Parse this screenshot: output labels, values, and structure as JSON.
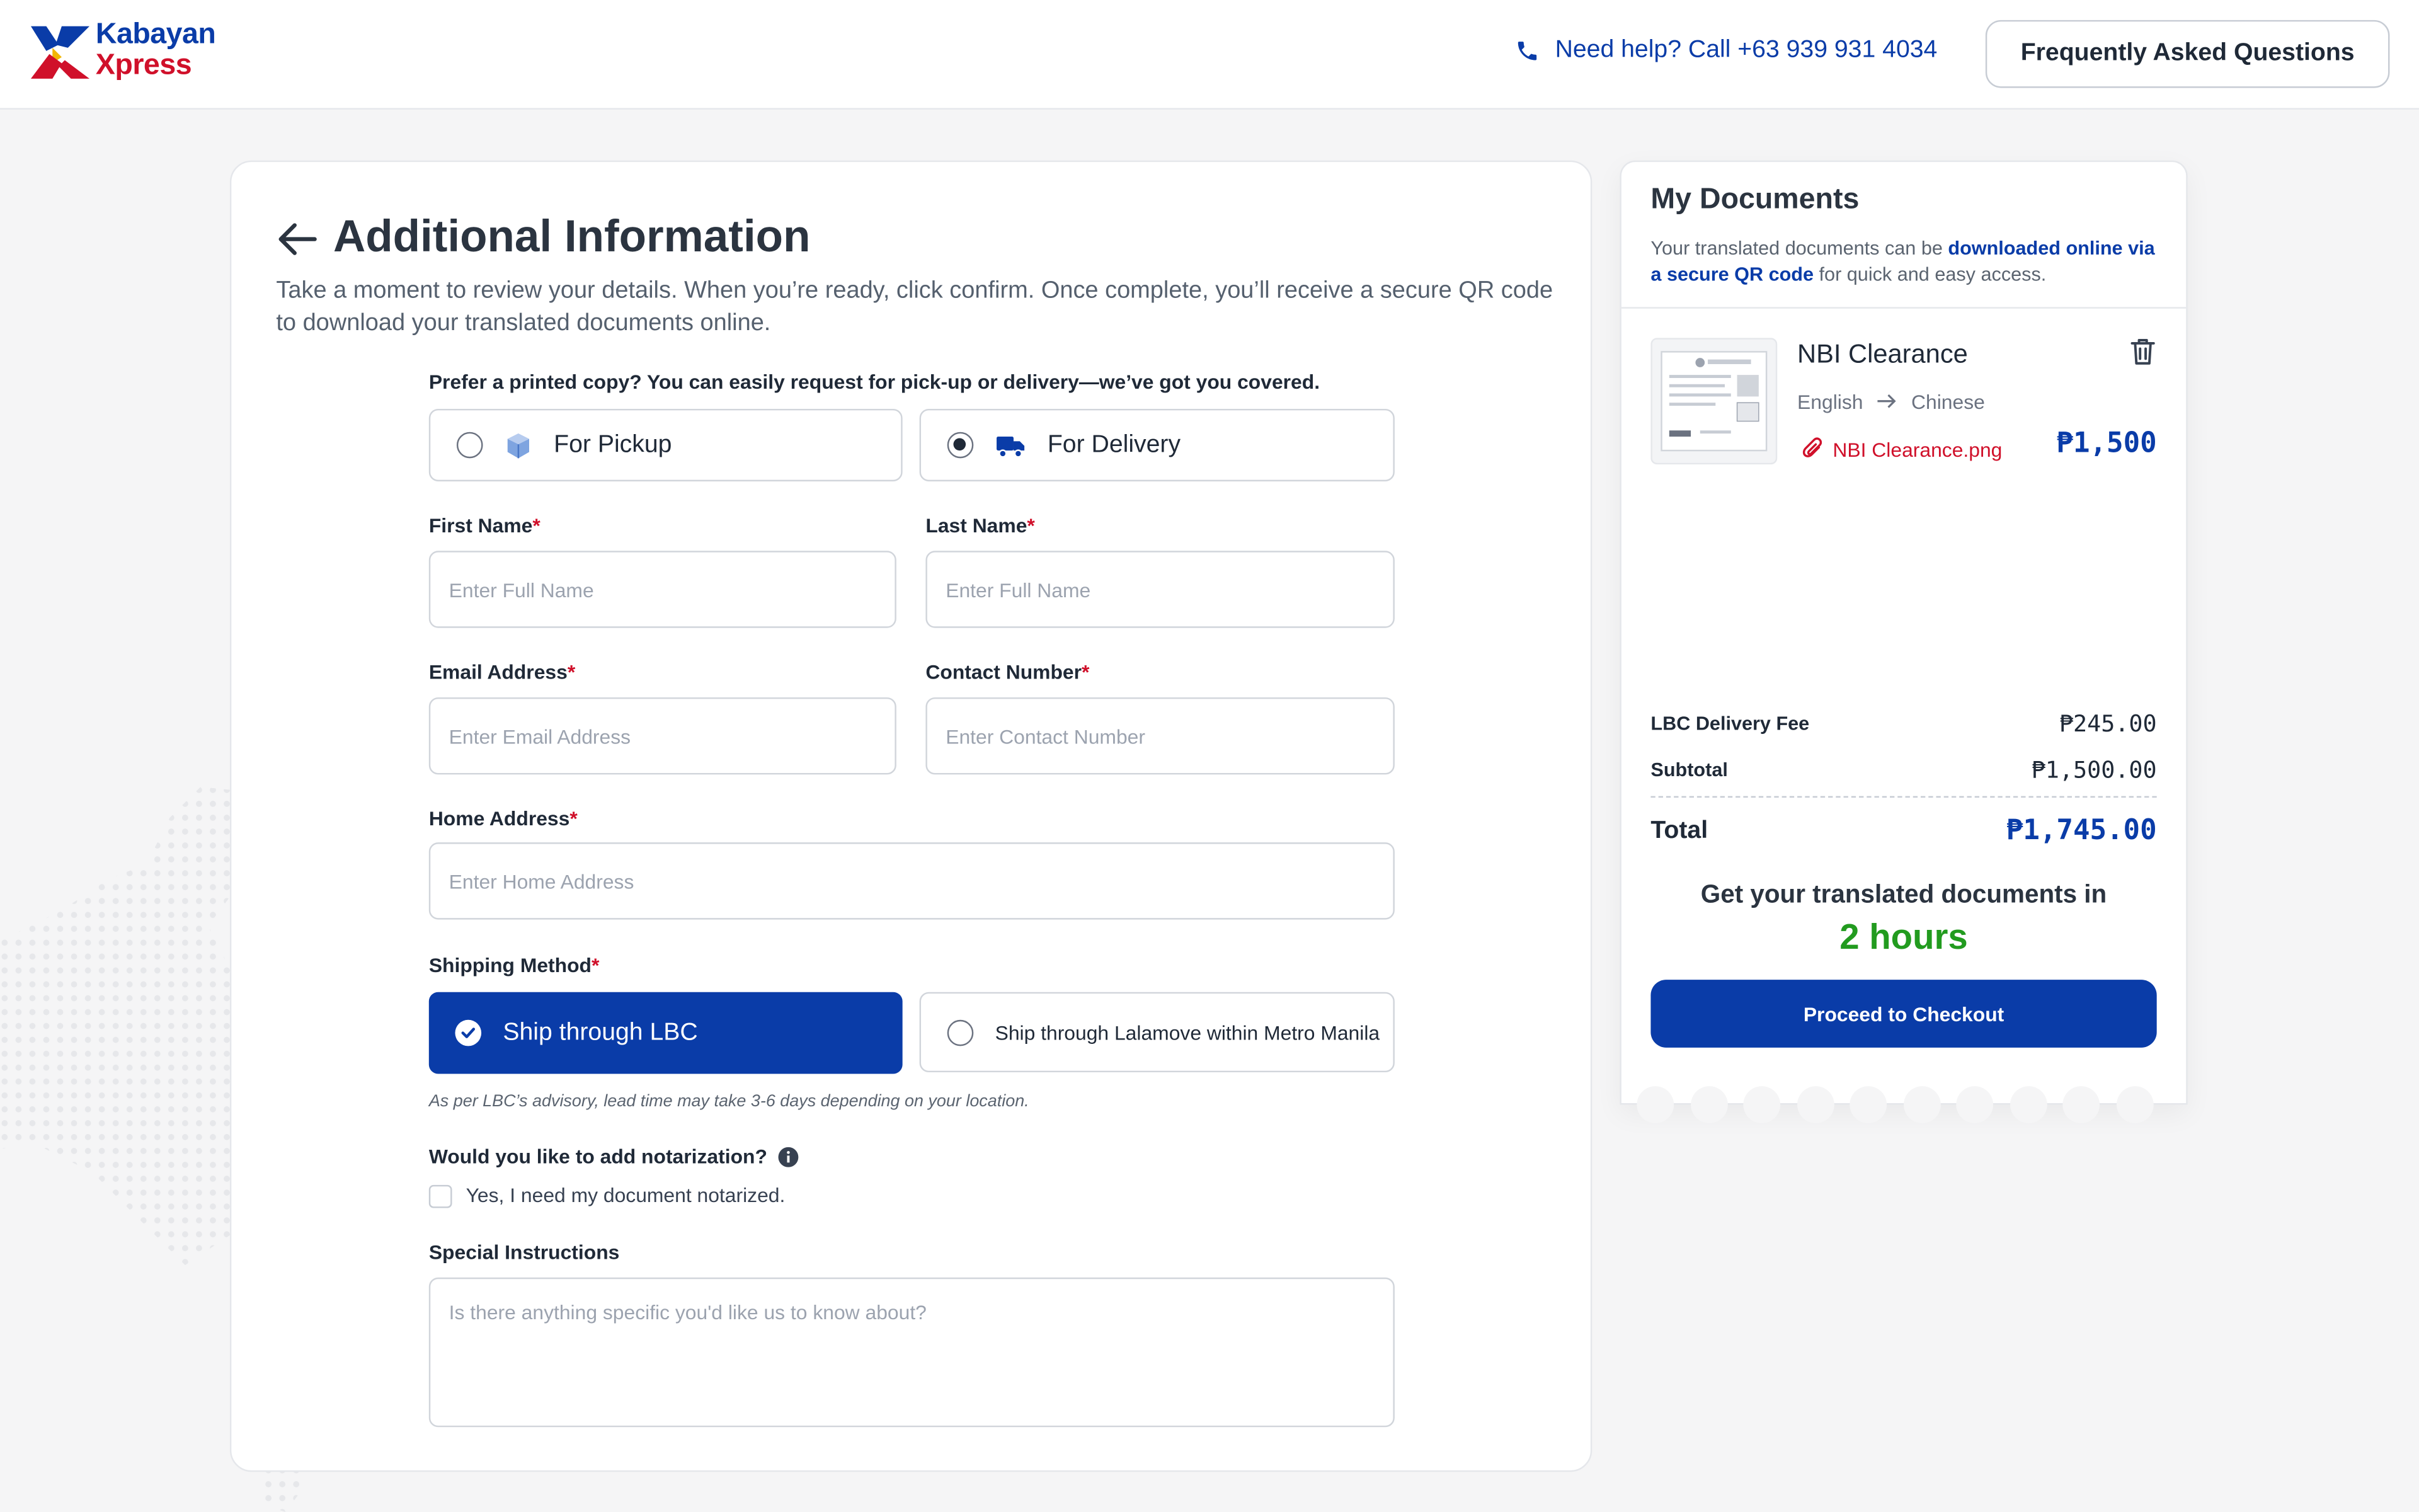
{
  "header": {
    "brand_line1": "Kabayan",
    "brand_line2": "Xpress",
    "help_text": "Need help? Call +63 939 931 4034",
    "faq_label": "Frequently Asked Questions"
  },
  "form": {
    "title": "Additional Information",
    "subtitle": "Take a moment to review your details. When you’re ready, click confirm. Once complete, you’ll receive a secure QR code to download your translated documents online.",
    "copy_question": "Prefer a printed copy? You can easily request for pick-up or delivery—we’ve got you covered.",
    "pickup_label": "For Pickup",
    "delivery_label": "For Delivery",
    "selected_copy_option": "For Delivery",
    "first_name": {
      "label": "First Name",
      "placeholder": "Enter Full Name",
      "value": ""
    },
    "last_name": {
      "label": "Last Name",
      "placeholder": "Enter Full Name",
      "value": ""
    },
    "email": {
      "label": "Email Address",
      "placeholder": "Enter Email Address",
      "value": ""
    },
    "contact": {
      "label": "Contact Number",
      "placeholder": "Enter Contact Number",
      "value": ""
    },
    "address": {
      "label": "Home Address",
      "placeholder": "Enter Home Address",
      "value": ""
    },
    "required_mark": "*",
    "shipping_label": "Shipping Method",
    "ship_lbc": "Ship through LBC",
    "ship_lalamove": "Ship through Lalamove within Metro Manila",
    "selected_shipping": "Ship through LBC",
    "shipping_note": "As per LBC’s advisory, lead time may take 3-6 days depending on your location.",
    "notarization_question": "Would you like to add notarization?",
    "notarization_option": "Yes, I need my document notarized.",
    "notarization_checked": false,
    "special_label": "Special Instructions",
    "special_placeholder": "Is there anything specific you'd like us to know about?"
  },
  "side": {
    "title": "My Documents",
    "desc_pre": "Your translated documents can be ",
    "desc_bold": "downloaded online via a secure QR code",
    "desc_post": " for quick and easy access.",
    "doc": {
      "name": "NBI Clearance",
      "from_lang": "English",
      "to_lang": "Chinese",
      "file": "NBI Clearance.png",
      "price": "₱1,500"
    },
    "delivery_fee_label": "LBC Delivery Fee",
    "delivery_fee": "₱245.00",
    "subtotal_label": "Subtotal",
    "subtotal": "₱1,500.00",
    "total_label": "Total",
    "total": "₱1,745.00",
    "eta_text": "Get your translated documents in",
    "eta_value": "2 hours",
    "checkout_label": "Proceed to Checkout"
  },
  "colors": {
    "brand_blue": "#0a3ca8",
    "brand_red": "#d0102a",
    "eta_green": "#229b1f"
  }
}
